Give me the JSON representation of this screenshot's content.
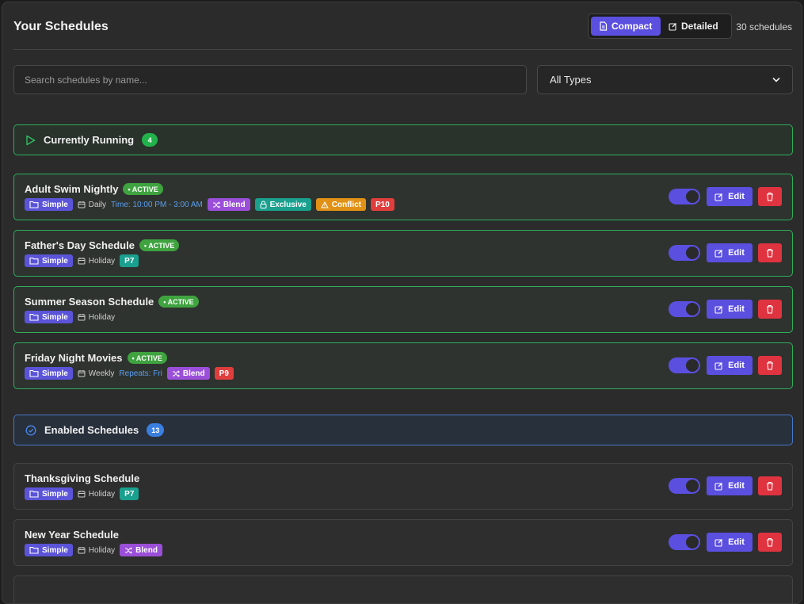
{
  "header": {
    "title": "Your Schedules",
    "view_compact": "Compact",
    "view_detailed": "Detailed",
    "count": "30 schedules"
  },
  "filters": {
    "search_placeholder": "Search schedules by name...",
    "type_selected": "All Types"
  },
  "sections": {
    "running": {
      "label": "Currently Running",
      "count": "4"
    },
    "enabled": {
      "label": "Enabled Schedules",
      "count": "13"
    }
  },
  "cards": [
    {
      "name": "Adult Swim Nightly",
      "active": "• ACTIVE",
      "type": "Simple",
      "freq": "Daily",
      "extra": "Time: 10:00 PM - 3:00 AM",
      "blend": "Blend",
      "exclusive": "Exclusive",
      "conflict": "Conflict",
      "priority": "P10"
    },
    {
      "name": "Father's Day Schedule",
      "active": "• ACTIVE",
      "type": "Simple",
      "freq": "Holiday",
      "priority": "P7"
    },
    {
      "name": "Summer Season Schedule",
      "active": "• ACTIVE",
      "type": "Simple",
      "freq": "Holiday"
    },
    {
      "name": "Friday Night Movies",
      "active": "• ACTIVE",
      "type": "Simple",
      "freq": "Weekly",
      "extra": "Repeats: Fri",
      "blend": "Blend",
      "priority": "P9"
    },
    {
      "name": "Thanksgiving Schedule",
      "type": "Simple",
      "freq": "Holiday",
      "priority": "P7"
    },
    {
      "name": "New Year Schedule",
      "type": "Simple",
      "freq": "Holiday",
      "blend": "Blend"
    }
  ],
  "actions": {
    "edit": "Edit"
  },
  "colors": {
    "accent": "#5b4fe0",
    "running_border": "#2fae5b",
    "enabled_border": "#4878c8",
    "delete": "#e03340"
  }
}
